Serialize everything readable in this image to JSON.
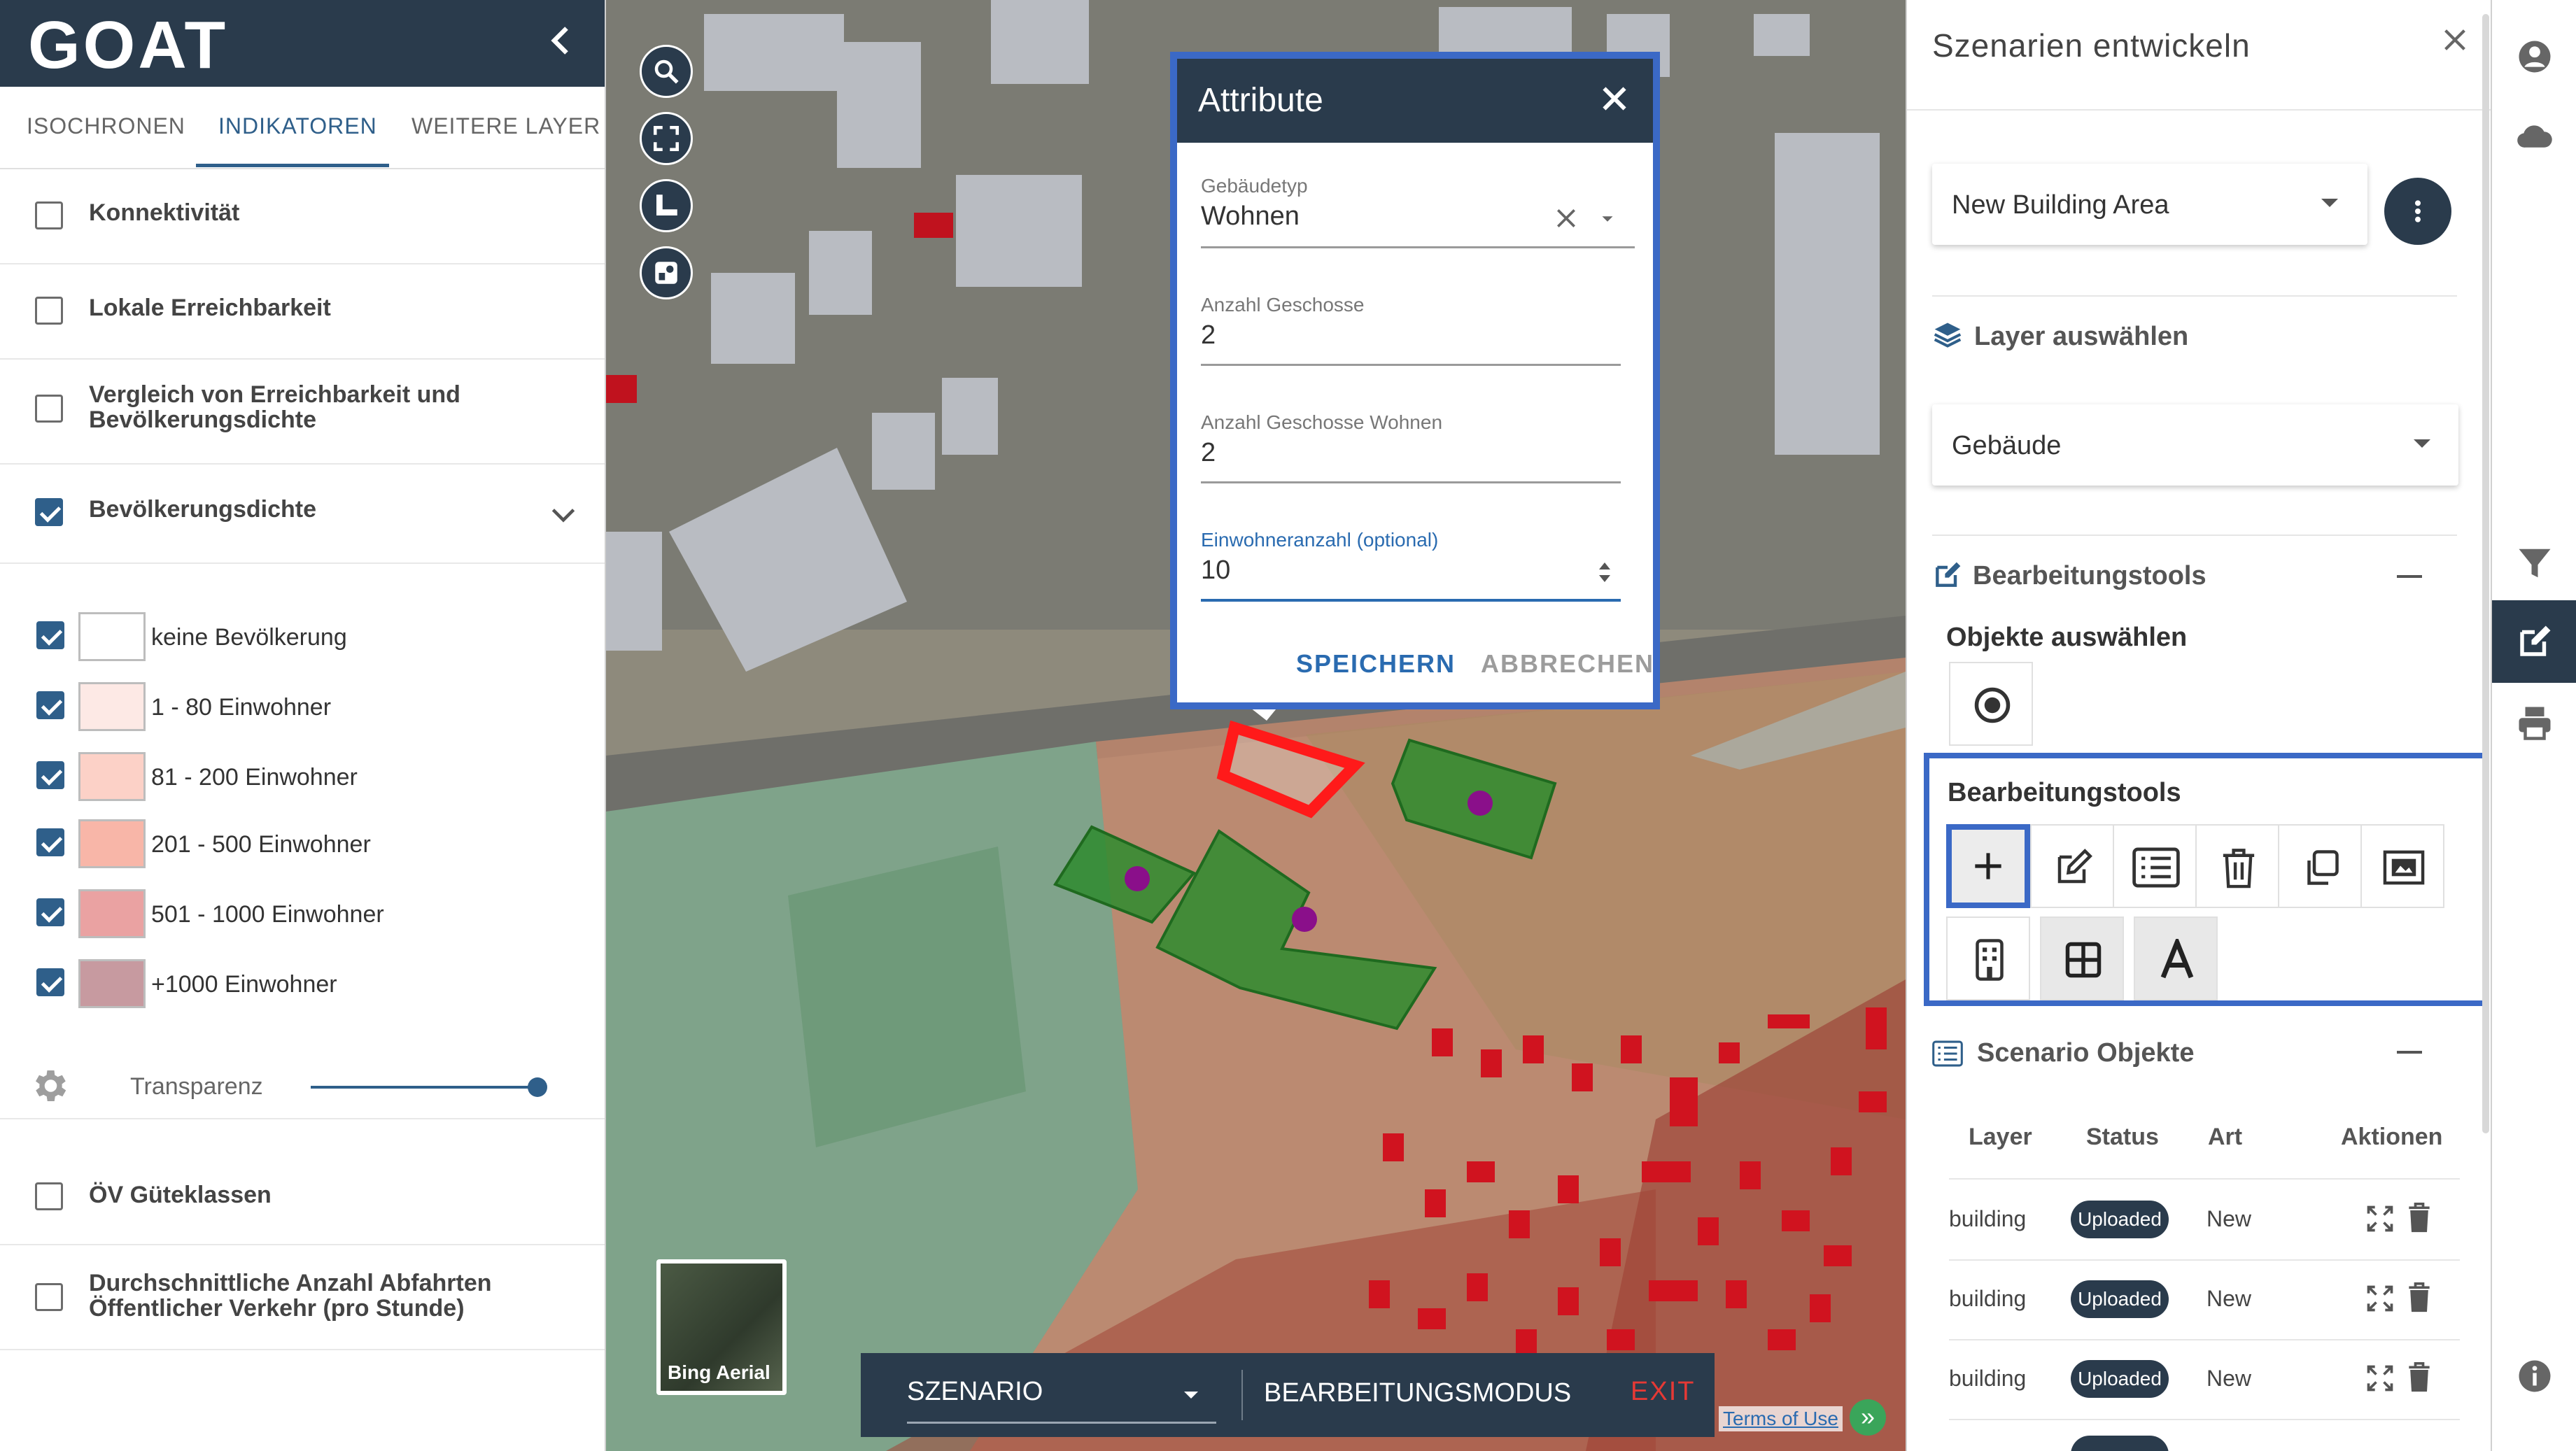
{
  "app": {
    "logo": "GOAT"
  },
  "left_panel": {
    "tabs": [
      {
        "label": "ISOCHRONEN"
      },
      {
        "label": "INDIKATOREN",
        "active": true
      },
      {
        "label": "WEITERE LAYER"
      }
    ],
    "indicators": [
      {
        "label": "Konnektivität",
        "checked": false
      },
      {
        "label": "Lokale Erreichbarkeit",
        "checked": false
      },
      {
        "label_line1": "Vergleich von Erreichbarkeit und",
        "label_line2": "Bevölkerungsdichte",
        "checked": false
      },
      {
        "label": "Bevölkerungsdichte",
        "checked": true,
        "expanded": true
      },
      {
        "label": "ÖV Güteklassen",
        "checked": false
      },
      {
        "label_line1": "Durchschnittliche Anzahl Abfahrten",
        "label_line2": "Öffentlicher Verkehr (pro Stunde)",
        "checked": false
      }
    ],
    "legend": [
      {
        "label": "keine Bevölkerung",
        "color": "#ffffff"
      },
      {
        "label": "1 - 80 Einwohner",
        "color": "#fde9e5"
      },
      {
        "label": "81 - 200 Einwohner",
        "color": "#fcd1c7"
      },
      {
        "label": "201 - 500 Einwohner",
        "color": "#f8b6a8"
      },
      {
        "label": "501 - 1000 Einwohner",
        "color": "#eaa2a2"
      },
      {
        "label": "+1000 Einwohner",
        "color": "#c79aa0"
      }
    ],
    "transparency": {
      "label": "Transparenz",
      "value": 0.9
    }
  },
  "map": {
    "basemap_label": "Bing Aerial",
    "scenario_bar": {
      "scenario": "SZENARIO",
      "mode": "BEARBEITUNGSMODUS",
      "exit": "EXIT"
    },
    "terms": "Terms of Use"
  },
  "attribute_dialog": {
    "title": "Attribute",
    "fields": [
      {
        "label": "Gebäudetyp",
        "value": "Wohnen"
      },
      {
        "label": "Anzahl Geschosse",
        "value": "2"
      },
      {
        "label": "Anzahl Geschosse Wohnen",
        "value": "2"
      },
      {
        "label": "Einwohneranzahl (optional)",
        "value": "10"
      }
    ],
    "save": "SPEICHERN",
    "cancel": "ABBRECHEN"
  },
  "right_panel": {
    "title": "Szenarien entwickeln",
    "scenario_select": "New Building Area",
    "layer_section": "Layer auswählen",
    "layer_select": "Gebäude",
    "edit_section": "Bearbeitungstools",
    "select_objects": "Objekte auswählen",
    "edit_tools_heading": "Bearbeitungstools",
    "scenario_objects": {
      "title": "Scenario Objekte",
      "columns": [
        "Layer",
        "Status",
        "Art",
        "Aktionen"
      ],
      "rows": [
        {
          "layer": "building",
          "status": "Uploaded",
          "type": "New"
        },
        {
          "layer": "building",
          "status": "Uploaded",
          "type": "New"
        },
        {
          "layer": "building",
          "status": "Uploaded",
          "type": "New"
        }
      ]
    }
  },
  "colors": {
    "header_dark": "#2a3b4c",
    "accent_blue": "#2f5f8a",
    "highlight_border": "#3b69c6",
    "exit_red": "#e53935",
    "new_building_green": "#2e8b2e",
    "selected_red": "#ff0000"
  }
}
